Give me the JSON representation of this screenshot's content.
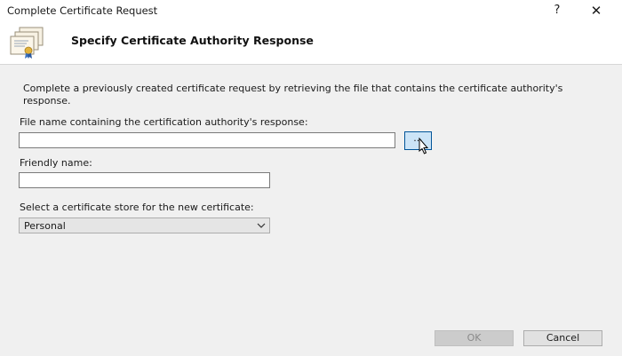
{
  "window": {
    "title": "Complete Certificate Request",
    "help_label": "?",
    "close_label": "✕"
  },
  "header": {
    "title": "Specify Certificate Authority Response",
    "icon": "certificate-icon"
  },
  "form": {
    "intro": "Complete a previously created certificate request by retrieving the file that contains the certificate authority's response.",
    "file_label": "File name containing the certification authority's response:",
    "file_value": "",
    "browse_label": "...",
    "friendly_label": "Friendly name:",
    "friendly_value": "",
    "store_label": "Select a certificate store for the new certificate:",
    "store_value": "Personal"
  },
  "footer": {
    "ok_label": "OK",
    "cancel_label": "Cancel"
  },
  "colors": {
    "accent_border": "#005499",
    "accent_fill": "#cce4f7"
  }
}
